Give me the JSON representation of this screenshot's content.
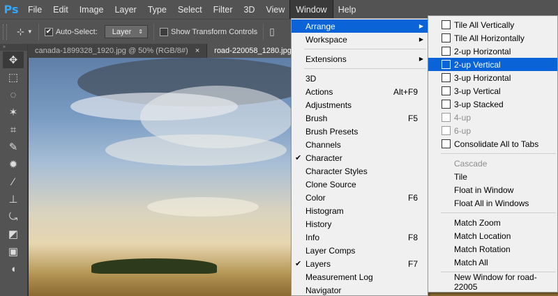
{
  "app": {
    "logo": "Ps"
  },
  "menubar": {
    "items": [
      "File",
      "Edit",
      "Image",
      "Layer",
      "Type",
      "Select",
      "Filter",
      "3D",
      "View",
      "Window",
      "Help"
    ],
    "active": "Window"
  },
  "options": {
    "auto_select_label": "Auto-Select:",
    "auto_select_checked": "✔",
    "target_value": "Layer",
    "show_transform_label": "Show Transform Controls"
  },
  "tabs": [
    {
      "label": "canada-1899328_1920.jpg @ 50% (RGB/8#)",
      "close": "×"
    },
    {
      "label": "road-220058_1280.jpg",
      "close": ""
    }
  ],
  "window_menu": {
    "items": [
      {
        "label": "Arrange",
        "submenu": true
      },
      {
        "label": "Workspace",
        "submenu": true
      },
      {
        "sep": true
      },
      {
        "label": "Extensions",
        "submenu": true
      },
      {
        "sep": true
      },
      {
        "label": "3D"
      },
      {
        "label": "Actions",
        "accel": "Alt+F9"
      },
      {
        "label": "Adjustments"
      },
      {
        "label": "Brush",
        "accel": "F5"
      },
      {
        "label": "Brush Presets"
      },
      {
        "label": "Channels"
      },
      {
        "label": "Character",
        "checked": true
      },
      {
        "label": "Character Styles"
      },
      {
        "label": "Clone Source"
      },
      {
        "label": "Color",
        "accel": "F6"
      },
      {
        "label": "Histogram"
      },
      {
        "label": "History"
      },
      {
        "label": "Info",
        "accel": "F8"
      },
      {
        "label": "Layer Comps"
      },
      {
        "label": "Layers",
        "accel": "F7",
        "checked": true
      },
      {
        "label": "Measurement Log"
      },
      {
        "label": "Navigator"
      }
    ]
  },
  "arrange_menu": {
    "items": [
      {
        "label": "Tile All Vertically",
        "icon": "tile-vertical-icon"
      },
      {
        "label": "Tile All Horizontally",
        "icon": "tile-horizontal-icon"
      },
      {
        "label": "2-up Horizontal",
        "icon": "two-up-horizontal-icon"
      },
      {
        "label": "2-up Vertical",
        "icon": "two-up-vertical-icon",
        "highlighted": true
      },
      {
        "label": "3-up Horizontal",
        "icon": "three-up-horizontal-icon"
      },
      {
        "label": "3-up Vertical",
        "icon": "three-up-vertical-icon"
      },
      {
        "label": "3-up Stacked",
        "icon": "three-up-stacked-icon"
      },
      {
        "label": "4-up",
        "icon": "four-up-icon",
        "disabled": true
      },
      {
        "label": "6-up",
        "icon": "six-up-icon",
        "disabled": true
      },
      {
        "label": "Consolidate All to Tabs",
        "icon": "consolidate-tabs-icon"
      },
      {
        "sep": true
      },
      {
        "label": "Cascade",
        "disabled": true
      },
      {
        "label": "Tile"
      },
      {
        "label": "Float in Window"
      },
      {
        "label": "Float All in Windows"
      },
      {
        "sep": true
      },
      {
        "label": "Match Zoom"
      },
      {
        "label": "Match Location"
      },
      {
        "label": "Match Rotation"
      },
      {
        "label": "Match All"
      },
      {
        "sep": true
      },
      {
        "label": "New Window for road-22005"
      }
    ]
  },
  "colors": {
    "highlight": "#0a64d8",
    "menubar": "#535353",
    "logo": "#31a8ff"
  }
}
